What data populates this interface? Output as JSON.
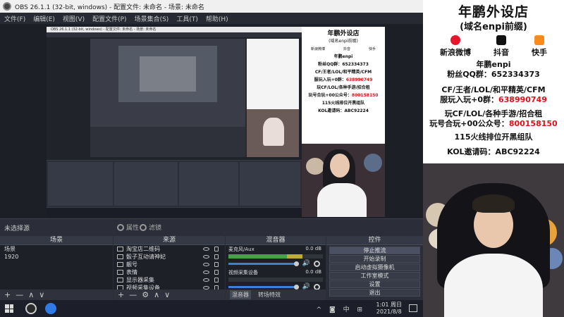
{
  "window": {
    "title": "OBS 26.1.1 (32-bit, windows) - 配置文件: 未命名 - 场景: 未命名"
  },
  "menu": [
    "文件(F)",
    "编辑(E)",
    "视图(V)",
    "配置文件(P)",
    "场景集合(S)",
    "工具(T)",
    "帮助(H)"
  ],
  "dockbar": {
    "current_scene": "未选择源",
    "properties": "属性",
    "filters": "滤镜"
  },
  "scenes": {
    "header": "场景",
    "items": [
      "场景",
      "1920"
    ],
    "footer": [
      "+",
      "—",
      "∧",
      "∨"
    ]
  },
  "sources": {
    "header": "来源",
    "items": [
      "淘宝店二维码",
      "骰子互动请神妃",
      "靓号",
      "表情",
      "显示器采集",
      "视频采集设备"
    ],
    "footer": [
      "+",
      "—",
      "⚙",
      "∧",
      "∨"
    ]
  },
  "mixer": {
    "header": "混音器",
    "channels": [
      {
        "name": "麦克风/Aux",
        "db": "0.0 dB",
        "level": 0.78
      },
      {
        "name": "视频采集设备",
        "db": "0.0 dB",
        "level": 0.0
      }
    ],
    "tabs": [
      "混音器",
      "转场特效"
    ]
  },
  "controls": {
    "header": "控件",
    "buttons": [
      "停止推流",
      "开始录制",
      "启动虚拟摄像机",
      "工作室模式",
      "设置",
      "退出"
    ]
  },
  "taskbar": {
    "time": "1:01 周日",
    "date": "2021/8/8",
    "tray": "^ ◙ 中 ⊞"
  },
  "banner": {
    "title": "年鹏外设店",
    "subtitle": "(域名enpi前缀)",
    "socials": [
      "新浪微博",
      "抖音",
      "快手"
    ],
    "author": "年鹏enpi",
    "fan_group_label": "粉丝QQ群：",
    "fan_group": "652334373",
    "line1": "CF/王者/LOL/和平精英/CFM",
    "line2_label": "服玩入玩+0群：",
    "line2_value": "638990749",
    "line3": "玩CF/LOL/各种手游/招合租",
    "line4_label": "玩号合玩+00公众号：",
    "line4_value": "800158150",
    "line5": "115火线排位开黑组队",
    "line6": "KOL邀请码：ABC92224"
  },
  "colors": {
    "accent_red": "#e0101a",
    "obs_bg": "#2b2e38",
    "meter_green": "#4aa84a",
    "fader_blue": "#3f7fd8"
  }
}
